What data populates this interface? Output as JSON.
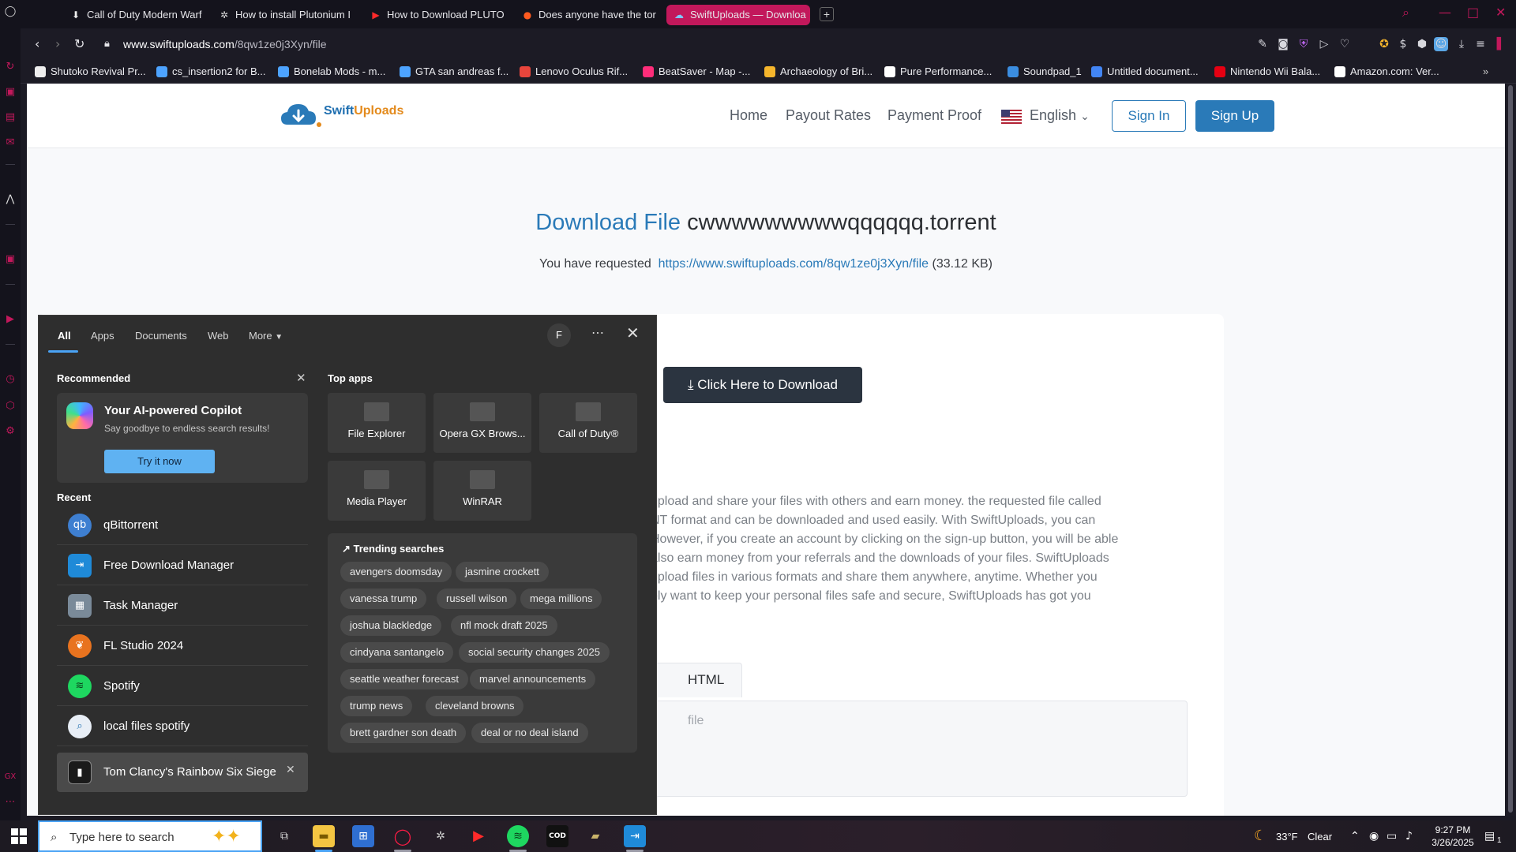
{
  "browser": {
    "tabs": [
      {
        "title": "Call of Duty Modern Warf",
        "icon": "download-arrow-icon"
      },
      {
        "title": "How to install Plutonium I",
        "icon": "gear-icon"
      },
      {
        "title": "How to Download PLUTO",
        "icon": "youtube-icon"
      },
      {
        "title": "Does anyone have the tor",
        "icon": "reddit-icon"
      },
      {
        "title": "SwiftUploads — Downloa",
        "icon": "cloud-icon",
        "active": true
      }
    ],
    "url_host": "www.swiftuploads.com",
    "url_path": "/8qw1ze0j3Xyn/file",
    "bookmarks": [
      "Shutoko Revival Pr...",
      "cs_insertion2 for B...",
      "Bonelab Mods - m...",
      "GTA san andreas f...",
      "Lenovo Oculus Rif...",
      "BeatSaver - Map -...",
      "Archaeology of Bri...",
      "Pure Performance...",
      "Soundpad_1",
      "Untitled document...",
      "Nintendo Wii Bala...",
      "Amazon.com: Ver..."
    ],
    "accent_color": "#c2185b"
  },
  "site": {
    "logo_a": "Swift",
    "logo_b": "Uploads",
    "nav": {
      "home": "Home",
      "payout": "Payout Rates",
      "proof": "Payment Proof",
      "language": "English",
      "signin": "Sign In",
      "signup": "Sign Up"
    },
    "title_label": "Download File",
    "file_name": "cwwwwwwwwwqqqqqq.torrent",
    "request_prefix": "You have requested",
    "request_link": "https://www.swiftuploads.com/8qw1ze0j3Xyn/file",
    "request_size": "(33.12 KB)",
    "download_button": "Click Here to Download",
    "description_lines": [
      "upload and share your files with others and earn money. the requested file called",
      "NT format and can be downloaded and used easily. With SwiftUploads, you can",
      "However, if you create an account by clicking on the sign-up button, you will be able",
      "also earn money from your referrals and the downloads of your files. SwiftUploads",
      "upload files in various formats and share them anywhere, anytime. Whether you",
      "ply want to keep your personal files safe and secure, SwiftUploads has got you"
    ],
    "html_code_tab": "HTML Code",
    "code_text": "file",
    "brand_color": "#2a7ab8"
  },
  "search_panel": {
    "tabs": [
      "All",
      "Apps",
      "Documents",
      "Web",
      "More"
    ],
    "avatar": "F",
    "recommended_heading": "Recommended",
    "copilot_title": "Your AI-powered Copilot",
    "copilot_subtitle": "Say goodbye to endless search results!",
    "copilot_button": "Try it now",
    "recent_heading": "Recent",
    "recent": [
      {
        "label": "qBittorrent",
        "icon": "qbittorrent-icon"
      },
      {
        "label": "Free Download Manager",
        "icon": "fdm-icon"
      },
      {
        "label": "Task Manager",
        "icon": "task-manager-icon"
      },
      {
        "label": "FL Studio 2024",
        "icon": "fl-studio-icon"
      },
      {
        "label": "Spotify",
        "icon": "spotify-icon"
      },
      {
        "label": "local files spotify",
        "icon": "search-icon"
      },
      {
        "label": "Tom Clancy's Rainbow Six Siege",
        "icon": "rainbow-six-icon",
        "selected": true
      }
    ],
    "top_apps_heading": "Top apps",
    "top_apps": [
      "File Explorer",
      "Opera GX Brows...",
      "Call of Duty®",
      "Media Player",
      "WinRAR"
    ],
    "trending_heading": "Trending searches",
    "trending": [
      "avengers doomsday",
      "jasmine crockett",
      "vanessa trump",
      "russell wilson",
      "mega millions",
      "joshua blackledge",
      "nfl mock draft 2025",
      "cindyana santangelo",
      "social security changes 2025",
      "seattle weather forecast",
      "marvel announcements",
      "trump news",
      "cleveland browns",
      "brett gardner son death",
      "deal or no deal island"
    ]
  },
  "taskbar": {
    "search_placeholder": "Type here to search",
    "weather_temp": "33°F",
    "weather_text": "Clear",
    "time": "9:27 PM",
    "date": "3/26/2025",
    "notification_count": "1"
  }
}
